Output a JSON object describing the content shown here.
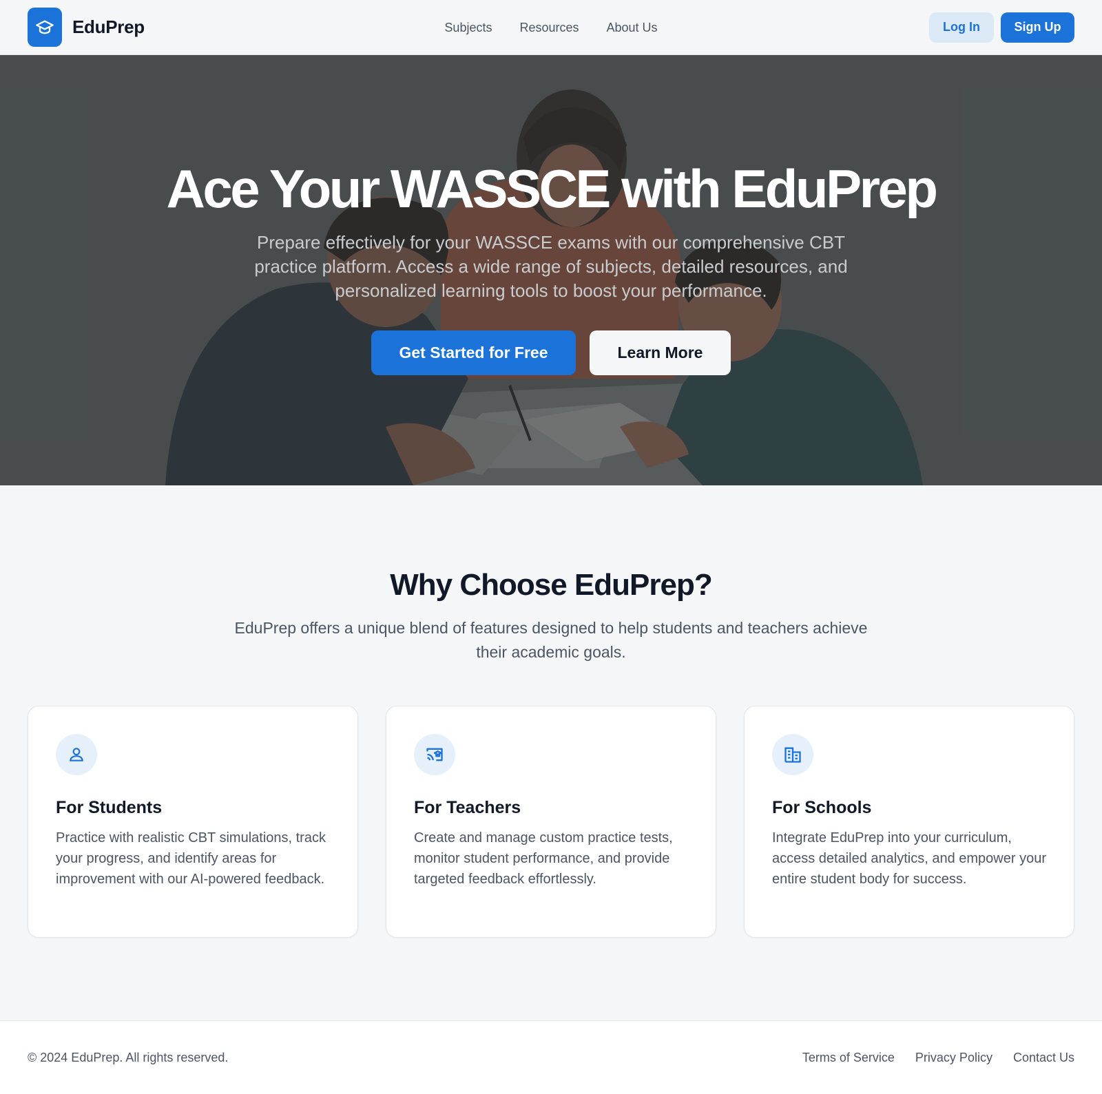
{
  "header": {
    "brand_name": "EduPrep",
    "nav": [
      "Subjects",
      "Resources",
      "About Us"
    ],
    "login_label": "Log In",
    "signup_label": "Sign Up"
  },
  "hero": {
    "title": "Ace Your WASSCE with EduPrep",
    "subtitle": "Prepare effectively for your WASSCE exams with our comprehensive CBT practice platform. Access a wide range of subjects, detailed resources, and personalized learning tools to boost your performance.",
    "primary_cta": "Get Started for Free",
    "secondary_cta": "Learn More"
  },
  "features": {
    "title": "Why Choose EduPrep?",
    "subtitle": "EduPrep offers a unique blend of features designed to help students and teachers achieve their academic goals.",
    "cards": [
      {
        "icon": "person-icon",
        "title": "For Students",
        "text": "Practice with realistic CBT simulations, track your progress, and identify areas for improvement with our AI-powered feedback."
      },
      {
        "icon": "cast-for-education-icon",
        "title": "For Teachers",
        "text": "Create and manage custom practice tests, monitor student performance, and provide targeted feedback effortlessly."
      },
      {
        "icon": "domain-building-icon",
        "title": "For Schools",
        "text": "Integrate EduPrep into your curriculum, access detailed analytics, and empower your entire student body for success."
      }
    ]
  },
  "footer": {
    "copyright": "© 2024 EduPrep. All rights reserved.",
    "links": [
      "Terms of Service",
      "Privacy Policy",
      "Contact Us"
    ]
  },
  "colors": {
    "primary": "#1b73d9",
    "primary_light": "#dce9f7",
    "background": "#f5f6f8",
    "text": "#111827",
    "muted_text": "#4b5563"
  }
}
